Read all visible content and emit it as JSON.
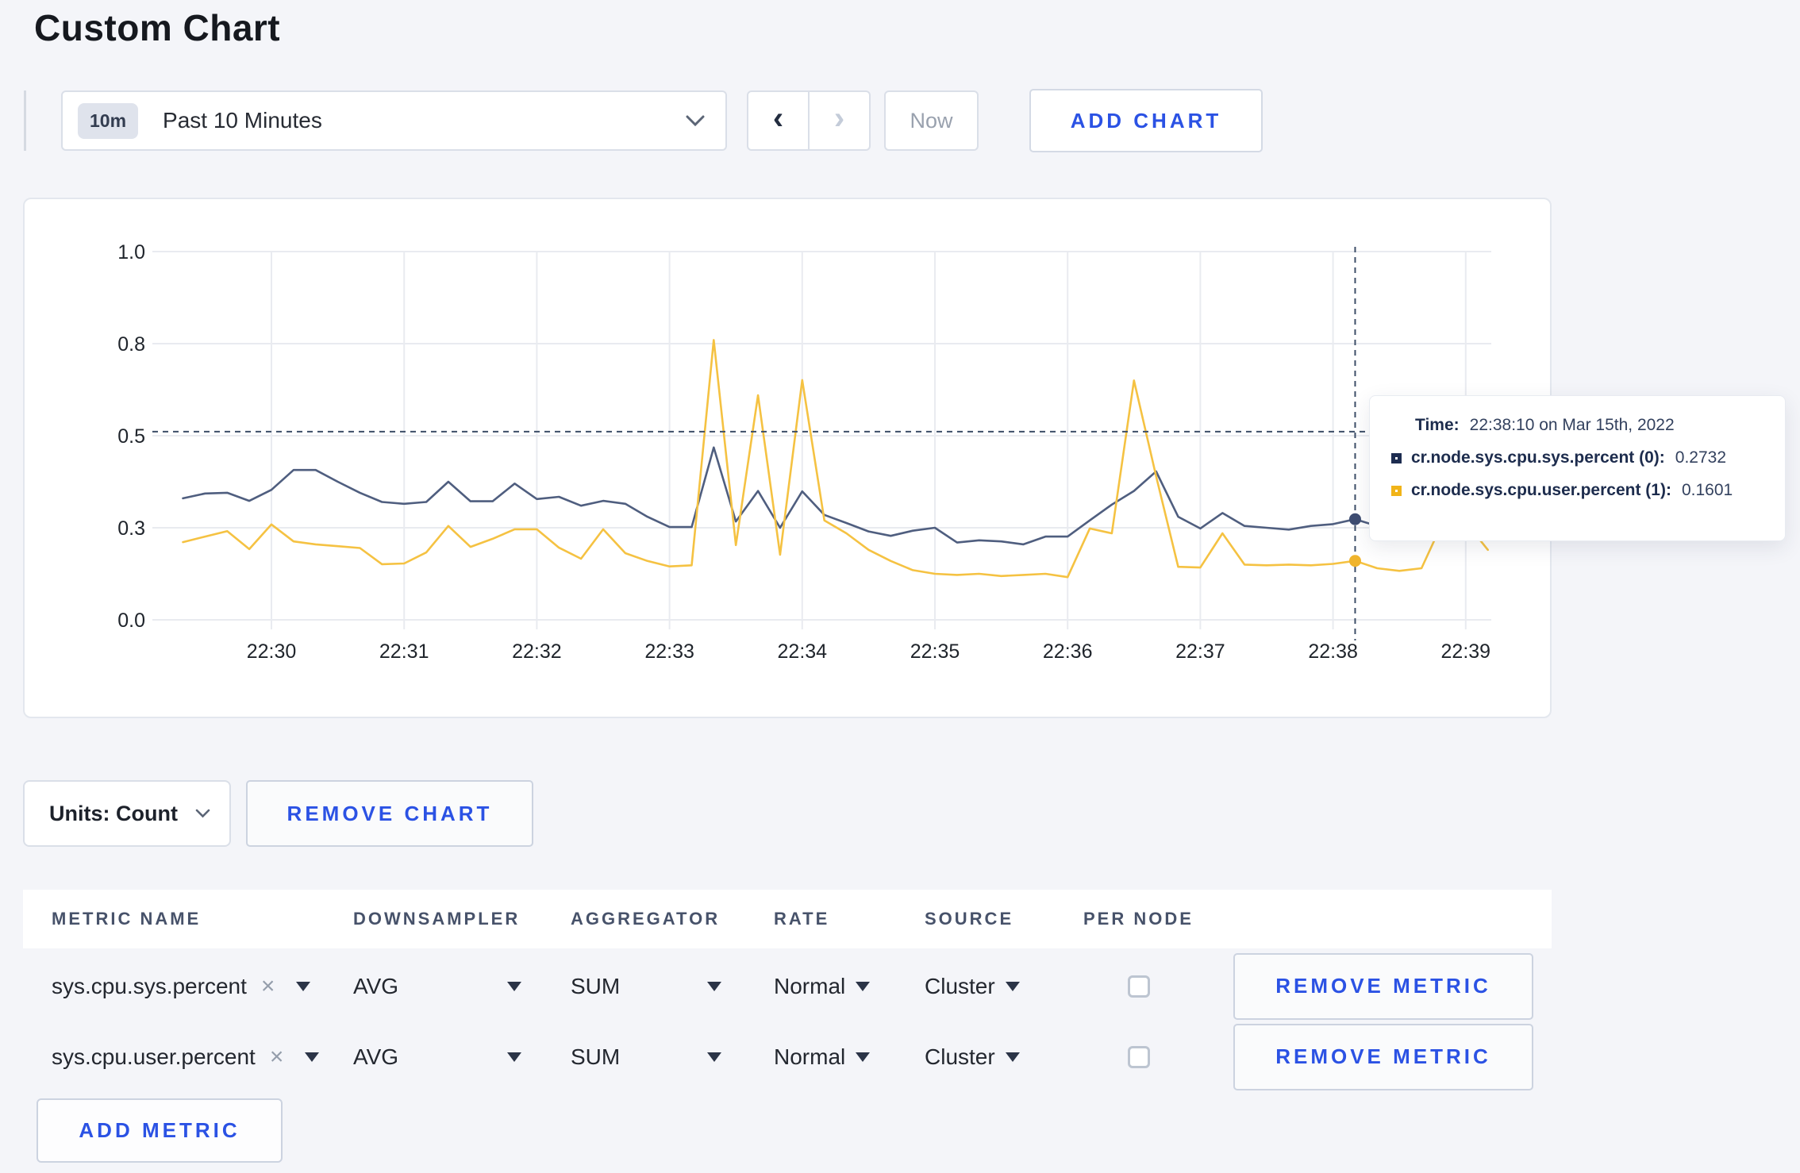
{
  "page": {
    "title": "Custom Chart",
    "background": "#f4f5f9",
    "accent_blue": "#2b52e4"
  },
  "toolbar": {
    "time_badge": "10m",
    "time_label": "Past 10 Minutes",
    "prev_icon": "‹",
    "next_icon": "›",
    "now_label": "Now",
    "add_chart_label": "ADD CHART"
  },
  "tooltip": {
    "time_label": "Time:",
    "time_value": "22:38:10 on Mar 15th, 2022",
    "series": [
      {
        "name": "cr.node.sys.cpu.sys.percent (0):",
        "value": "0.2732",
        "color": "#1d2c50"
      },
      {
        "name": "cr.node.sys.cpu.user.percent (1):",
        "value": "0.1601",
        "color": "#f1b418"
      }
    ]
  },
  "chart_controls": {
    "units_label": "Units: Count",
    "remove_chart_label": "REMOVE CHART"
  },
  "metrics_table": {
    "columns": [
      "METRIC NAME",
      "DOWNSAMPLER",
      "AGGREGATOR",
      "RATE",
      "SOURCE",
      "PER NODE"
    ],
    "rows": [
      {
        "metric": "sys.cpu.sys.percent",
        "remove_icon": "×",
        "downsampler": "AVG",
        "aggregator": "SUM",
        "rate": "Normal",
        "source": "Cluster",
        "per_node_checked": false,
        "remove_label": "REMOVE METRIC"
      },
      {
        "metric": "sys.cpu.user.percent",
        "remove_icon": "×",
        "downsampler": "AVG",
        "aggregator": "SUM",
        "rate": "Normal",
        "source": "Cluster",
        "per_node_checked": false,
        "remove_label": "REMOVE METRIC"
      }
    ],
    "add_metric_label": "ADD METRIC"
  },
  "chart_data": {
    "type": "line",
    "title": "",
    "xlabel": "",
    "ylabel": "",
    "ylim": [
      0,
      1
    ],
    "grid": true,
    "legend_position": "none",
    "y_ticks": [
      {
        "value": 0,
        "label": "0.0"
      },
      {
        "value": 0.25,
        "label": "0.3"
      },
      {
        "value": 0.5,
        "label": "0.5"
      },
      {
        "value": 0.75,
        "label": "0.8"
      },
      {
        "value": 1,
        "label": "1.0"
      }
    ],
    "x_tick_labels": [
      "22:30",
      "22:31",
      "22:32",
      "22:33",
      "22:34",
      "22:35",
      "22:36",
      "22:37",
      "22:38",
      "22:39"
    ],
    "x": [
      "22:29:20",
      "22:29:30",
      "22:29:40",
      "22:29:50",
      "22:30:00",
      "22:30:10",
      "22:30:20",
      "22:30:30",
      "22:30:40",
      "22:30:50",
      "22:31:00",
      "22:31:10",
      "22:31:20",
      "22:31:30",
      "22:31:40",
      "22:31:50",
      "22:32:00",
      "22:32:10",
      "22:32:20",
      "22:32:30",
      "22:32:40",
      "22:32:50",
      "22:33:00",
      "22:33:10",
      "22:33:20",
      "22:33:30",
      "22:33:40",
      "22:33:50",
      "22:34:00",
      "22:34:10",
      "22:34:20",
      "22:34:30",
      "22:34:40",
      "22:34:50",
      "22:35:00",
      "22:35:10",
      "22:35:20",
      "22:35:30",
      "22:35:40",
      "22:35:50",
      "22:36:00",
      "22:36:10",
      "22:36:20",
      "22:36:30",
      "22:36:40",
      "22:36:50",
      "22:37:00",
      "22:37:10",
      "22:37:20",
      "22:37:30",
      "22:37:40",
      "22:37:50",
      "22:38:00",
      "22:38:10",
      "22:38:20",
      "22:38:30",
      "22:38:40",
      "22:38:50",
      "22:39:00",
      "22:39:10"
    ],
    "series": [
      {
        "name": "cr.node.sys.cpu.sys.percent",
        "color": "#4f5e7f",
        "values": [
          0.33,
          0.343,
          0.345,
          0.323,
          0.353,
          0.407,
          0.407,
          0.375,
          0.345,
          0.32,
          0.315,
          0.32,
          0.375,
          0.322,
          0.322,
          0.37,
          0.328,
          0.334,
          0.31,
          0.323,
          0.315,
          0.28,
          0.252,
          0.252,
          0.468,
          0.267,
          0.35,
          0.25,
          0.349,
          0.285,
          0.263,
          0.24,
          0.228,
          0.242,
          0.25,
          0.21,
          0.216,
          0.213,
          0.205,
          0.226,
          0.226,
          0.27,
          0.313,
          0.35,
          0.403,
          0.28,
          0.248,
          0.29,
          0.255,
          0.25,
          0.245,
          0.255,
          0.26,
          0.2732,
          0.255,
          0.262,
          0.272,
          0.285,
          0.292,
          0.275
        ]
      },
      {
        "name": "cr.node.sys.cpu.user.percent",
        "color": "#f5c242",
        "values": [
          0.211,
          0.226,
          0.241,
          0.192,
          0.259,
          0.213,
          0.205,
          0.2,
          0.195,
          0.151,
          0.153,
          0.183,
          0.255,
          0.198,
          0.22,
          0.246,
          0.246,
          0.196,
          0.166,
          0.246,
          0.181,
          0.16,
          0.145,
          0.148,
          0.76,
          0.203,
          0.61,
          0.177,
          0.651,
          0.27,
          0.235,
          0.19,
          0.16,
          0.135,
          0.125,
          0.122,
          0.125,
          0.119,
          0.122,
          0.125,
          0.116,
          0.248,
          0.235,
          0.65,
          0.39,
          0.144,
          0.142,
          0.235,
          0.15,
          0.148,
          0.15,
          0.148,
          0.152,
          0.1601,
          0.14,
          0.133,
          0.14,
          0.27,
          0.265,
          0.19
        ]
      }
    ],
    "crosshair": {
      "x": "22:38:10",
      "y_value": 0.511,
      "points": [
        {
          "series": 0,
          "value": 0.2732,
          "dot_color": "#3e4d72"
        },
        {
          "series": 1,
          "value": 0.1601,
          "dot_color": "#f0b42c"
        }
      ]
    }
  }
}
